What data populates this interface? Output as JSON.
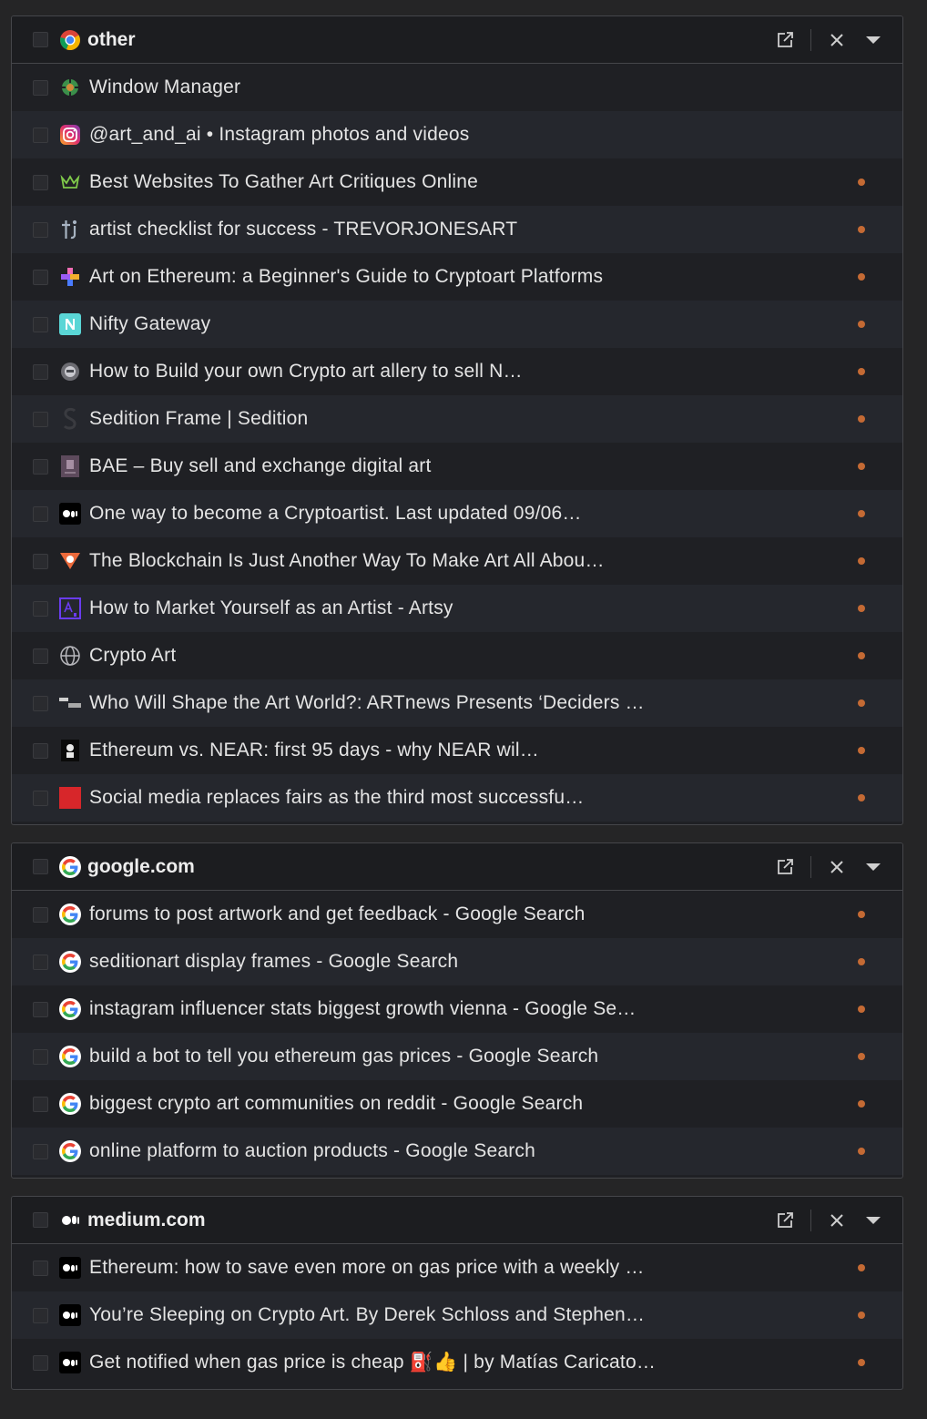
{
  "groups": [
    {
      "title": "other",
      "icon": "chrome-icon",
      "tabs": [
        {
          "title": "Window Manager",
          "icon": "window-manager-icon",
          "dot": false
        },
        {
          "title": "@art_and_ai • Instagram photos and videos",
          "icon": "instagram-icon",
          "dot": false
        },
        {
          "title": "Best Websites To Gather Art Critiques Online",
          "icon": "crown-icon",
          "dot": true
        },
        {
          "title": "artist checklist for success - TREVORJONESART",
          "icon": "tj-icon",
          "dot": true
        },
        {
          "title": "Art on Ethereum: a Beginner's Guide to Cryptoart Platforms",
          "icon": "plus-colorful-icon",
          "dot": true
        },
        {
          "title": "Nifty Gateway",
          "icon": "nifty-n-icon",
          "dot": true
        },
        {
          "title": "How to Build your own Crypto art allery to sell N…",
          "icon": "robot-icon",
          "dot": true
        },
        {
          "title": "Sedition Frame | Sedition",
          "icon": "sedition-s-icon",
          "dot": true
        },
        {
          "title": "BAE – Buy sell and exchange digital art",
          "icon": "bae-icon",
          "dot": true
        },
        {
          "title": "One way to become a Cryptoartist. Last updated 09/06…",
          "icon": "medium-icon",
          "dot": true
        },
        {
          "title": "The Blockchain Is Just Another Way To Make Art All Abou…",
          "icon": "triangle-logo-icon",
          "dot": true
        },
        {
          "title": "How to Market Yourself as an Artist - Artsy",
          "icon": "artsy-icon",
          "dot": true
        },
        {
          "title": "Crypto Art",
          "icon": "globe-icon",
          "dot": true
        },
        {
          "title": "Who Will Shape the Art World?: ARTnews Presents ‘Deciders …",
          "icon": "artnews-icon",
          "dot": true
        },
        {
          "title": "Ethereum vs. NEAR: first 95 days - why NEAR wil…",
          "icon": "portrait-icon",
          "dot": true
        },
        {
          "title": "Social media replaces fairs as the third most successfu…",
          "icon": "red-square-icon",
          "dot": true
        }
      ]
    },
    {
      "title": "google.com",
      "icon": "google-icon",
      "tabs": [
        {
          "title": "forums to post artwork and get feedback - Google Search",
          "icon": "google-icon",
          "dot": true
        },
        {
          "title": "seditionart display frames - Google Search",
          "icon": "google-icon",
          "dot": true
        },
        {
          "title": "instagram influencer stats biggest growth vienna - Google Se…",
          "icon": "google-icon",
          "dot": true
        },
        {
          "title": "build a bot to tell you ethereum gas prices - Google Search",
          "icon": "google-icon",
          "dot": true
        },
        {
          "title": "biggest crypto art communities on reddit - Google Search",
          "icon": "google-icon",
          "dot": true
        },
        {
          "title": "online platform to auction products - Google Search",
          "icon": "google-icon",
          "dot": true
        }
      ]
    },
    {
      "title": "medium.com",
      "icon": "medium-icon",
      "tabs": [
        {
          "title": "Ethereum: how to save even more on gas price with a weekly …",
          "icon": "medium-icon",
          "dot": true
        },
        {
          "title": "You’re Sleeping on Crypto Art. By Derek Schloss and Stephen…",
          "icon": "medium-icon",
          "dot": true
        },
        {
          "title": "Get notified when gas price is cheap ⛽👍 | by Matías Caricato…",
          "icon": "medium-icon",
          "dot": true
        }
      ]
    }
  ],
  "colors": {
    "background": "#252526",
    "row_dark": "#1f2024",
    "row_light": "#25272d",
    "dot": "#c46a34",
    "border": "#45464a"
  }
}
